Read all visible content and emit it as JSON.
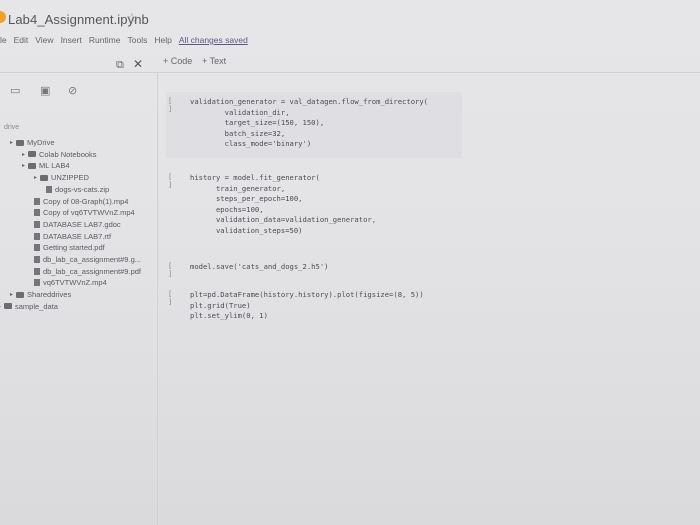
{
  "window": {
    "title": "Lab4_Assignment.ipynb"
  },
  "menu": [
    "le",
    "Edit",
    "View",
    "Insert",
    "Runtime",
    "Tools",
    "Help"
  ],
  "save_status": "All changes saved",
  "toolbar": {
    "code_label": "+ Code",
    "text_label": "+ Text"
  },
  "sidebar": {
    "drive_label": "drive",
    "tree": [
      {
        "label": "MyDrive",
        "type": "folder",
        "depth": 0
      },
      {
        "label": "Colab Notebooks",
        "type": "folder",
        "depth": 1
      },
      {
        "label": "ML LAB4",
        "type": "folder",
        "depth": 1
      },
      {
        "label": "UNZIPPED",
        "type": "folder",
        "depth": 2
      },
      {
        "label": "dogs-vs-cats.zip",
        "type": "file",
        "depth": 3
      },
      {
        "label": "Copy of 08-Graph(1).mp4",
        "type": "file",
        "depth": 2
      },
      {
        "label": "Copy of vq6TVTWVnZ.mp4",
        "type": "file",
        "depth": 2
      },
      {
        "label": "DATABASE LAB7.gdoc",
        "type": "file",
        "depth": 2
      },
      {
        "label": "DATABASE LAB7.rtf",
        "type": "file",
        "depth": 2
      },
      {
        "label": "Getting started.pdf",
        "type": "file",
        "depth": 2
      },
      {
        "label": "db_lab_ca_assignment#9.g...",
        "type": "file",
        "depth": 2
      },
      {
        "label": "db_lab_ca_assignment#9.pdf",
        "type": "file",
        "depth": 2
      },
      {
        "label": "vq6TVTWVnZ.mp4",
        "type": "file",
        "depth": 2
      },
      {
        "label": "Shareddrives",
        "type": "folder",
        "depth": 0
      },
      {
        "label": "sample_data",
        "type": "folder",
        "depth": -1
      }
    ]
  },
  "cells": [
    {
      "run": "[ ]",
      "code": "validation_generator = val_datagen.flow_from_directory(\n        validation_dir,\n        target_size=(150, 150),\n        batch_size=32,\n        class_mode='binary')"
    },
    {
      "run": "[ ]",
      "code": "history = model.fit_generator(\n      train_generator,\n      steps_per_epoch=100,\n      epochs=100,\n      validation_data=validation_generator,\n      validation_steps=50)"
    },
    {
      "run": "[ ]",
      "code": "model.save('cats_and_dogs_2.h5')"
    },
    {
      "run": "[ ]",
      "code": "plt=pd.DataFrame(history.history).plot(figsize=(8, 5))\nplt.grid(True)\nplt.set_ylim(0, 1)"
    }
  ]
}
